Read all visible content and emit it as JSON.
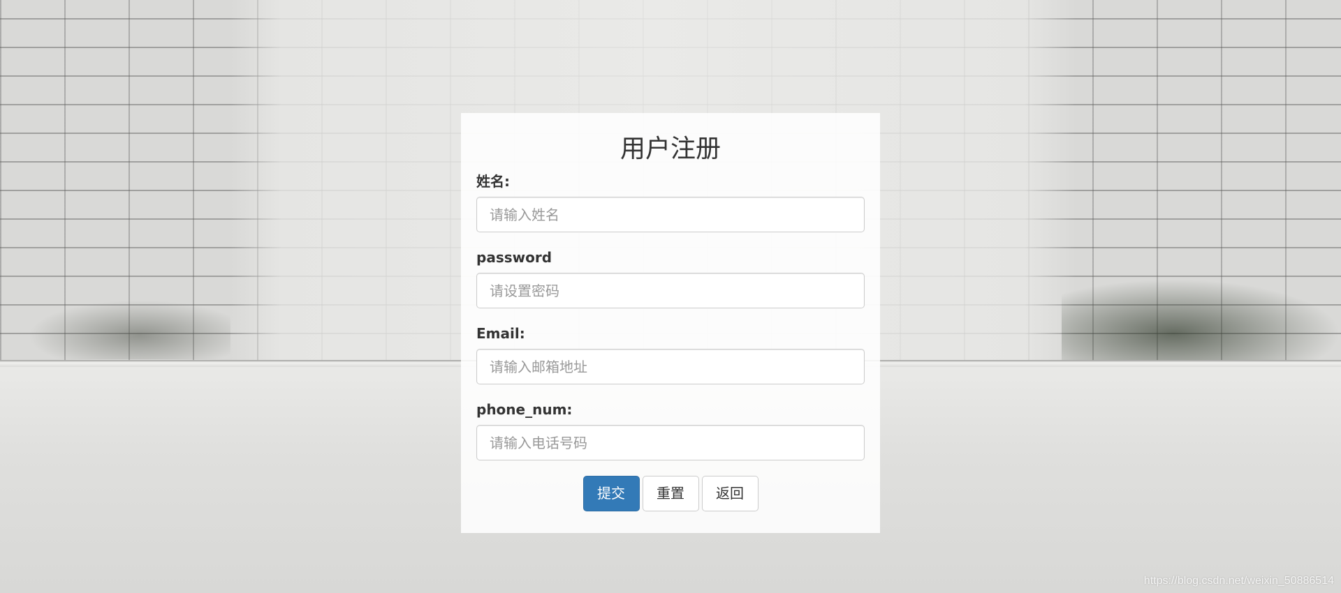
{
  "page": {
    "background": "brick-wall-photo",
    "watermark": "https://blog.csdn.net/weixin_50886514"
  },
  "form": {
    "title": "用户注册",
    "fields": [
      {
        "label": "姓名:",
        "placeholder": "请输入姓名",
        "value": ""
      },
      {
        "label": "password",
        "placeholder": "请设置密码",
        "value": ""
      },
      {
        "label": "Email:",
        "placeholder": "请输入邮箱地址",
        "value": ""
      },
      {
        "label": "phone_num:",
        "placeholder": "请输入电话号码",
        "value": ""
      }
    ],
    "buttons": {
      "submit": "提交",
      "reset": "重置",
      "back": "返回"
    },
    "colors": {
      "primary": "#337ab7",
      "card_background": "#ffffff",
      "text": "#333333",
      "placeholder": "#999999"
    }
  }
}
